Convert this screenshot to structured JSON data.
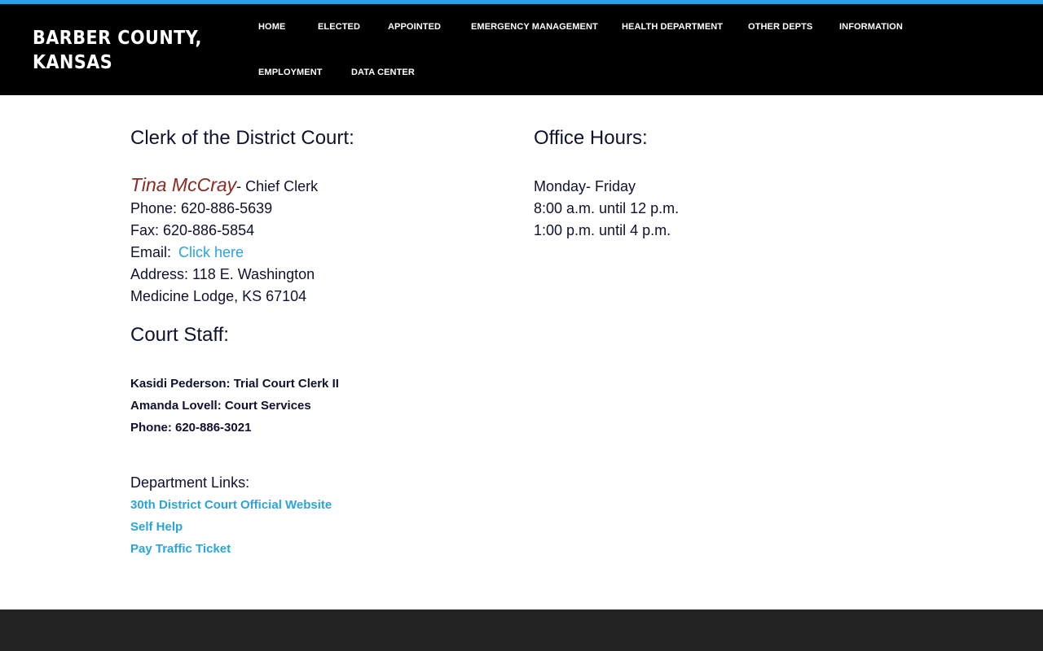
{
  "site": {
    "title_line1": "BARBER COUNTY,",
    "title_line2": "KANSAS"
  },
  "nav": {
    "home": "HOME",
    "elected": "ELECTED",
    "appointed": "APPOINTED",
    "emergency": "EMERGENCY MANAGEMENT",
    "health": "HEALTH DEPARTMENT",
    "other": "OTHER DEPTS",
    "information": "INFORMATION",
    "employment": "EMPLOYMENT",
    "data_center": "DATA CENTER"
  },
  "clerk": {
    "heading": "Clerk of the District Court:",
    "name": "Tina McCray",
    "role": "- Chief Clerk",
    "phone": "Phone: 620-886-5639",
    "fax": "Fax: 620-886-5854",
    "email_label": "Email:",
    "email_link": "Click here",
    "address1": "Address: 118 E. Washington",
    "address2": "Medicine Lodge, KS 67104"
  },
  "hours": {
    "heading": "Office Hours:",
    "days": "Monday- Friday",
    "morning": "8:00 a.m. until 12 p.m.",
    "afternoon": "1:00 p.m. until 4 p.m."
  },
  "staff": {
    "heading": "Court Staff:",
    "member1": "Kasidi Pederson: Trial Court Clerk II",
    "member2": "Amanda Lovell: Court Services",
    "phone": "Phone: 620-886-3021"
  },
  "links": {
    "heading": "Department Links:",
    "official": "30th District Court Official Website",
    "self_help": "Self Help",
    "traffic": "Pay Traffic Ticket"
  },
  "colors": {
    "accent": "#2aa4dd",
    "header_bg": "#000000",
    "footer_bg": "#222222",
    "clerk_name": "#8a2b22",
    "text": "#0e1230"
  }
}
